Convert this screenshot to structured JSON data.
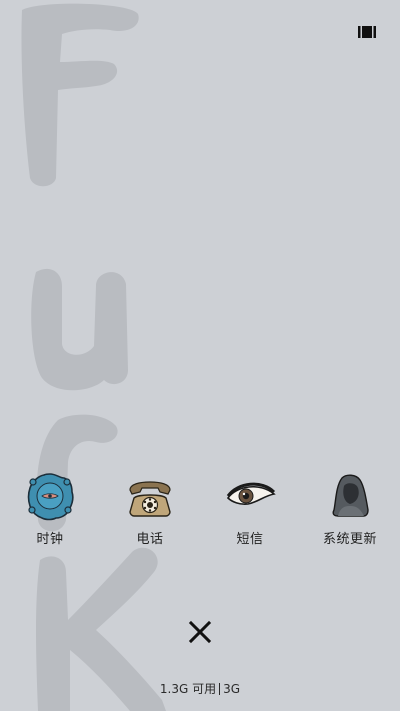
{
  "status": {
    "icon": "recent-apps-icon"
  },
  "wallpaper": {
    "art_text": "FUCK"
  },
  "apps": [
    {
      "label": "时钟",
      "icon": "clock-icon"
    },
    {
      "label": "电话",
      "icon": "telephone-icon"
    },
    {
      "label": "短信",
      "icon": "eye-icon"
    },
    {
      "label": "系统更新",
      "icon": "hooded-figure-icon"
    }
  ],
  "close": {
    "icon": "close-icon"
  },
  "memory": {
    "available": "1.3G 可用",
    "total": "3G"
  },
  "colors": {
    "background": "#cdd0d5",
    "clock_fill": "#3f8fb0",
    "phone_fill": "#bfa67a",
    "eye_iris": "#6b5440"
  }
}
